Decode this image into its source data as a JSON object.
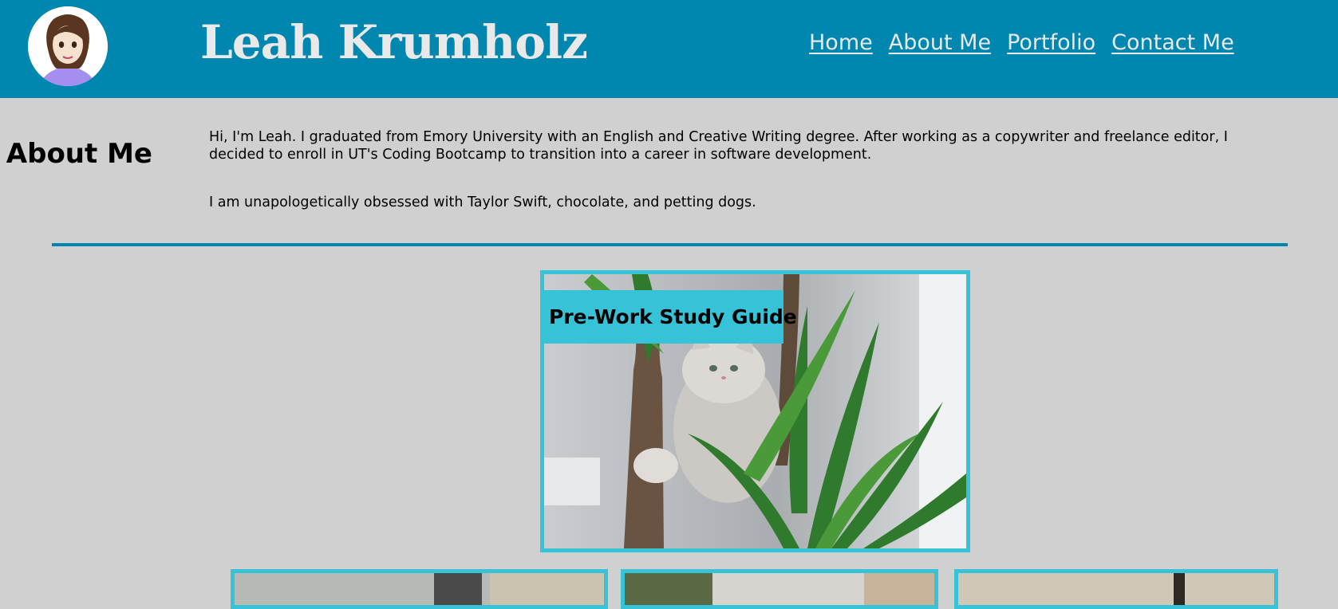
{
  "header": {
    "title": "Leah Krumholz",
    "nav": [
      "Home",
      "About Me",
      "Portfolio",
      "Contact Me"
    ]
  },
  "about": {
    "heading": "About Me",
    "paragraphs": [
      "Hi, I'm Leah. I graduated from Emory University with an English and Creative Writing degree. After working as a copywriter and freelance editor, I decided to enroll in UT's Coding Bootcamp to transition into a career in software development.",
      "I am unapologetically obsessed with Taylor Swift, chocolate, and petting dogs."
    ]
  },
  "portfolio": {
    "featured_label": "Pre-Work Study Guide"
  },
  "colors": {
    "header_bg": "#0087b0",
    "page_bg": "#d0d0d0",
    "card_accent": "#36c3d8",
    "header_text": "#e9e9e9"
  }
}
